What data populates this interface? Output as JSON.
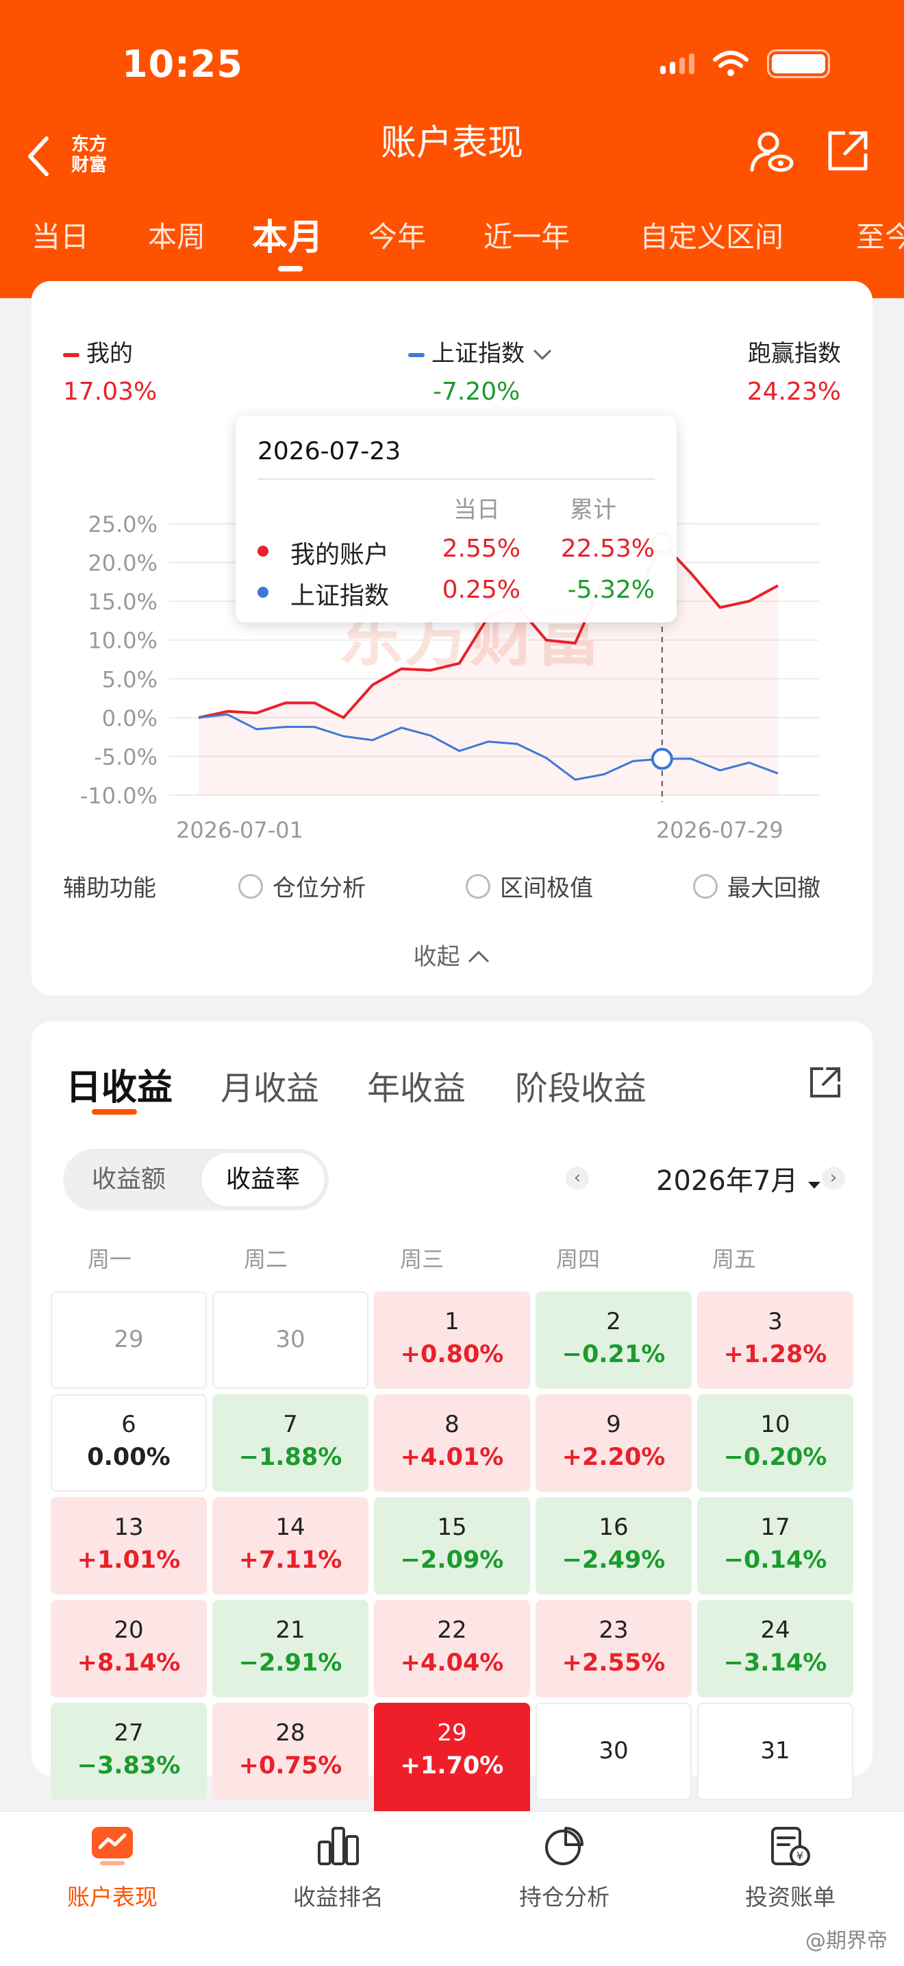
{
  "status_bar": {
    "time": "10:25"
  },
  "header": {
    "brand": [
      "东方",
      "财富"
    ],
    "title": "账户表现",
    "tabs": [
      "当日",
      "本周",
      "本月",
      "今年",
      "近一年",
      "自定义区间",
      "至今"
    ],
    "active_tab": "本月"
  },
  "summary": {
    "mine": {
      "label": "我的",
      "value": "17.03%"
    },
    "index": {
      "label": "上证指数",
      "value": "-7.20%"
    },
    "beat": {
      "label": "跑赢指数",
      "value": "24.23%"
    }
  },
  "tooltip": {
    "date": "2026-07-23",
    "col_day": "当日",
    "col_cum": "累计",
    "rows": [
      {
        "name": "我的账户",
        "day": "2.55%",
        "cum": "22.53%"
      },
      {
        "name": "上证指数",
        "day": "0.25%",
        "cum": "-5.32%"
      }
    ]
  },
  "chart_data": {
    "type": "line",
    "y_ticks": [
      "25.0%",
      "20.0%",
      "15.0%",
      "10.0%",
      "5.0%",
      "0.0%",
      "-5.0%",
      "-10.0%"
    ],
    "ylim": [
      -10,
      25
    ],
    "x_start_label": "2026-07-01",
    "x_end_label": "2026-07-29",
    "x": [
      "07-01",
      "07-02",
      "07-03",
      "07-06",
      "07-07",
      "07-08",
      "07-09",
      "07-10",
      "07-13",
      "07-14",
      "07-15",
      "07-16",
      "07-17",
      "07-20",
      "07-21",
      "07-22",
      "07-23",
      "07-24",
      "07-27",
      "07-28",
      "07-29"
    ],
    "series": [
      {
        "name": "我的账户",
        "color": "#e8212a",
        "values": [
          0.0,
          0.8,
          0.6,
          1.9,
          1.9,
          0.0,
          4.2,
          6.3,
          6.1,
          7.0,
          13.0,
          14.4,
          10.0,
          9.6,
          18.0,
          15.0,
          22.53,
          18.6,
          14.2,
          15.0,
          17.03
        ]
      },
      {
        "name": "上证指数",
        "color": "#3b78d8",
        "values": [
          0.0,
          0.4,
          -1.5,
          -1.2,
          -1.2,
          -2.4,
          -2.9,
          -1.3,
          -2.3,
          -4.3,
          -3.1,
          -3.4,
          -5.2,
          -8.0,
          -7.3,
          -5.6,
          -5.32,
          -5.3,
          -6.8,
          -5.8,
          -7.2
        ]
      }
    ],
    "highlight_index": 16,
    "watermark": "东方财富"
  },
  "aux": {
    "label": "辅助功能",
    "options": [
      "仓位分析",
      "区间极值",
      "最大回撤"
    ],
    "collapse": "收起"
  },
  "earnings": {
    "tabs": [
      "日收益",
      "月收益",
      "年收益",
      "阶段收益"
    ],
    "active_tab": "日收益",
    "segment": [
      "收益额",
      "收益率"
    ],
    "active_segment": "收益率",
    "month": "2026年7月",
    "weekdays": [
      "周一",
      "周二",
      "周三",
      "周四",
      "周五"
    ],
    "days": [
      {
        "day": "29",
        "pct": "",
        "kind": "gray"
      },
      {
        "day": "30",
        "pct": "",
        "kind": "gray"
      },
      {
        "day": "1",
        "pct": "+0.80%",
        "kind": "up"
      },
      {
        "day": "2",
        "pct": "−0.21%",
        "kind": "dn"
      },
      {
        "day": "3",
        "pct": "+1.28%",
        "kind": "up"
      },
      {
        "day": "6",
        "pct": "0.00%",
        "kind": "zero"
      },
      {
        "day": "7",
        "pct": "−1.88%",
        "kind": "dn"
      },
      {
        "day": "8",
        "pct": "+4.01%",
        "kind": "up"
      },
      {
        "day": "9",
        "pct": "+2.20%",
        "kind": "up"
      },
      {
        "day": "10",
        "pct": "−0.20%",
        "kind": "dn"
      },
      {
        "day": "13",
        "pct": "+1.01%",
        "kind": "up"
      },
      {
        "day": "14",
        "pct": "+7.11%",
        "kind": "up"
      },
      {
        "day": "15",
        "pct": "−2.09%",
        "kind": "dn"
      },
      {
        "day": "16",
        "pct": "−2.49%",
        "kind": "dn"
      },
      {
        "day": "17",
        "pct": "−0.14%",
        "kind": "dn"
      },
      {
        "day": "20",
        "pct": "+8.14%",
        "kind": "up"
      },
      {
        "day": "21",
        "pct": "−2.91%",
        "kind": "dn"
      },
      {
        "day": "22",
        "pct": "+4.04%",
        "kind": "up"
      },
      {
        "day": "23",
        "pct": "+2.55%",
        "kind": "up"
      },
      {
        "day": "24",
        "pct": "−3.14%",
        "kind": "dn"
      },
      {
        "day": "27",
        "pct": "−3.83%",
        "kind": "dn"
      },
      {
        "day": "28",
        "pct": "+0.75%",
        "kind": "up"
      },
      {
        "day": "29",
        "pct": "+1.70%",
        "kind": "sel"
      },
      {
        "day": "30",
        "pct": "",
        "kind": "future"
      },
      {
        "day": "31",
        "pct": "",
        "kind": "future"
      }
    ]
  },
  "bottom_nav": [
    {
      "label": "账户表现",
      "icon": "chart-screen-icon",
      "active": true
    },
    {
      "label": "收益排名",
      "icon": "bar-chart-icon",
      "active": false
    },
    {
      "label": "持仓分析",
      "icon": "pie-chart-icon",
      "active": false
    },
    {
      "label": "投资账单",
      "icon": "bill-icon",
      "active": false
    }
  ],
  "watermark": "@期界帝"
}
